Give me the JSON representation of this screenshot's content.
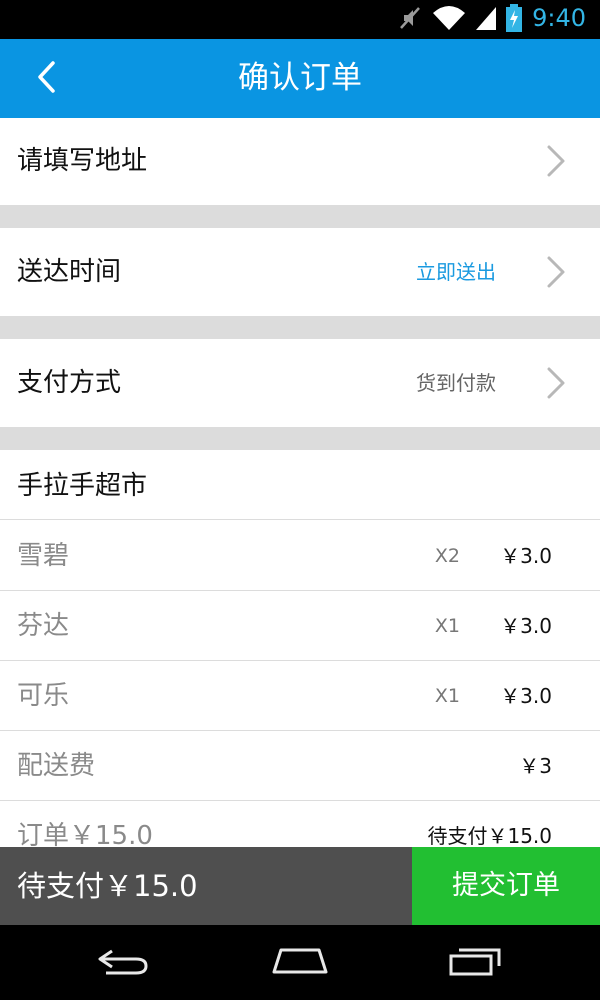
{
  "status_bar": {
    "time": "9:40",
    "icons": [
      "mute-icon",
      "wifi-icon",
      "signal-icon",
      "battery-charging-icon"
    ]
  },
  "header": {
    "title": "确认订单",
    "back_icon": "chevron-left-icon"
  },
  "address": {
    "label": "请填写地址"
  },
  "delivery_time": {
    "label": "送达时间",
    "value": "立即送出",
    "value_color": "#1a9ae0"
  },
  "payment": {
    "label": "支付方式",
    "value": "货到付款"
  },
  "shop": {
    "name": "手拉手超市"
  },
  "items": [
    {
      "name": "雪碧",
      "qty": "X2",
      "price": "￥3.0"
    },
    {
      "name": "芬达",
      "qty": "X1",
      "price": "￥3.0"
    },
    {
      "name": "可乐",
      "qty": "X1",
      "price": "￥3.0"
    }
  ],
  "delivery_fee": {
    "label": "配送费",
    "price": "￥3"
  },
  "order_summary": {
    "label": "订单￥15.0",
    "due": "待支付￥15.0"
  },
  "action_bar": {
    "due_label": "待支付￥15.0",
    "submit_label": "提交订单",
    "submit_color": "#22bf32"
  },
  "colors": {
    "header_bg": "#0a95e2",
    "divider": "#dcdcdc",
    "time_accent": "#33b5e5"
  }
}
